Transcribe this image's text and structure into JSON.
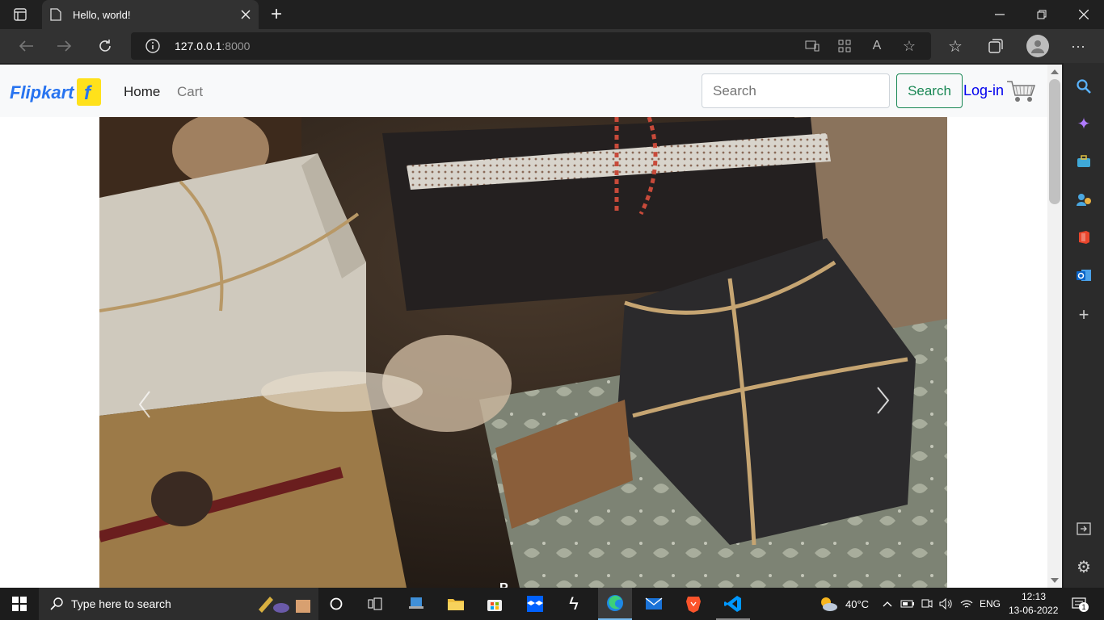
{
  "browser": {
    "tab_title": "Hello, world!",
    "url_host": "127.0.0.1",
    "url_port": ":8000"
  },
  "navbar": {
    "brand": "Flipkart",
    "home": "Home",
    "cart": "Cart",
    "search_placeholder": "Search",
    "search_button": "Search",
    "login": "Log-in"
  },
  "carousel": {
    "caption": "P..."
  },
  "taskbar": {
    "search_placeholder": "Type here to search",
    "weather": "40°C",
    "lang": "ENG",
    "time": "12:13",
    "date": "13-06-2022",
    "notifications": "1"
  }
}
